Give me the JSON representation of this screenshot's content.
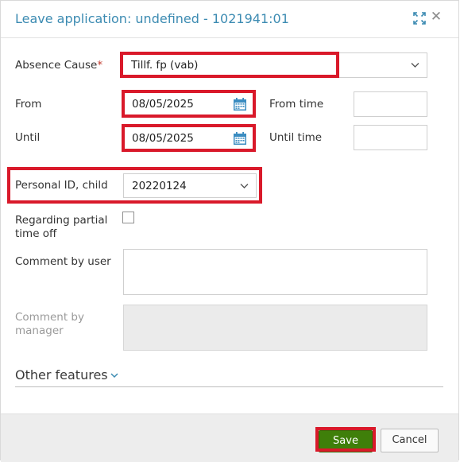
{
  "dialog": {
    "title": "Leave application: undefined - 1021941:01",
    "expand_icon": "expand-icon",
    "close_icon": "close-icon"
  },
  "form": {
    "absence_cause": {
      "label": "Absence Cause",
      "required_mark": "*",
      "value": "Tillf. fp (vab)"
    },
    "from": {
      "label": "From",
      "date": "08/05/2025",
      "time_label": "From time",
      "time_value": ""
    },
    "until": {
      "label": "Until",
      "date": "08/05/2025",
      "time_label": "Until time",
      "time_value": ""
    },
    "personal_id_child": {
      "label": "Personal ID, child",
      "value": "20220124"
    },
    "partial_time_off": {
      "label": "Regarding partial time off",
      "checked": false
    },
    "comment_user": {
      "label": "Comment by user",
      "value": ""
    },
    "comment_manager": {
      "label": "Comment by manager",
      "value": ""
    },
    "other_features": {
      "label": "Other features"
    }
  },
  "footer": {
    "save_label": "Save",
    "cancel_label": "Cancel"
  },
  "colors": {
    "title": "#3c8bb2",
    "highlight": "#d9192a",
    "save_button": "#3f7f0a",
    "calendar_icon": "#3a8cc1"
  }
}
